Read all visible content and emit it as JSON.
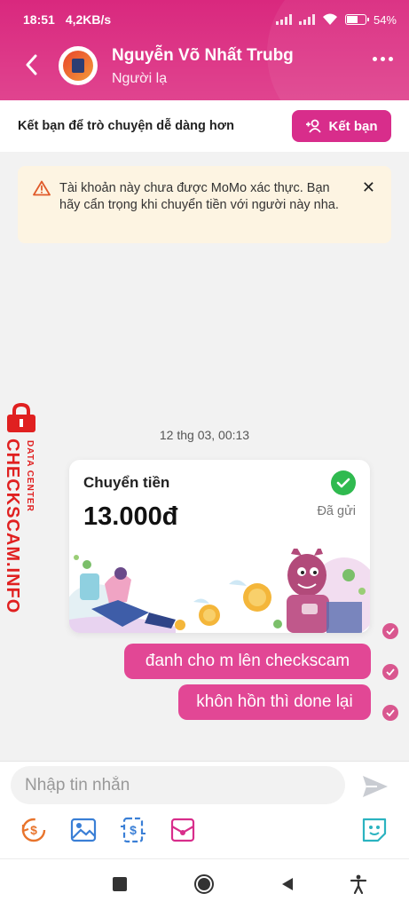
{
  "status_bar": {
    "time": "18:51",
    "speed": "4,2KB/s",
    "battery": "54%",
    "battery_level": 0.54
  },
  "header": {
    "contact_name": "Nguyễn Võ Nhất Trubg",
    "contact_subtitle": "Người lạ"
  },
  "friend_bar": {
    "text": "Kết bạn để trò chuyện dễ dàng hơn",
    "button_label": "Kết bạn"
  },
  "warning": {
    "text": "Tài khoản này chưa được MoMo xác thực. Bạn hãy cẩn trọng khi chuyển tiền với người này nha."
  },
  "watermark": {
    "brand": "CHECKSCAM.INFO",
    "tagline": "DATA CENTER"
  },
  "chat": {
    "timestamp": "12 thg 03, 00:13",
    "transfer": {
      "title": "Chuyển tiền",
      "amount": "13.000đ",
      "status": "Đã gửi"
    },
    "messages": [
      {
        "text": "đanh cho m lên checkscam"
      },
      {
        "text": "khôn hồn thì done lại"
      }
    ]
  },
  "composer": {
    "placeholder": "Nhập tin nhắn"
  },
  "colors": {
    "brand": "#d82d8b",
    "bubble": "#e24795",
    "success": "#2fba4f",
    "warning_bg": "#fdf4e2"
  }
}
